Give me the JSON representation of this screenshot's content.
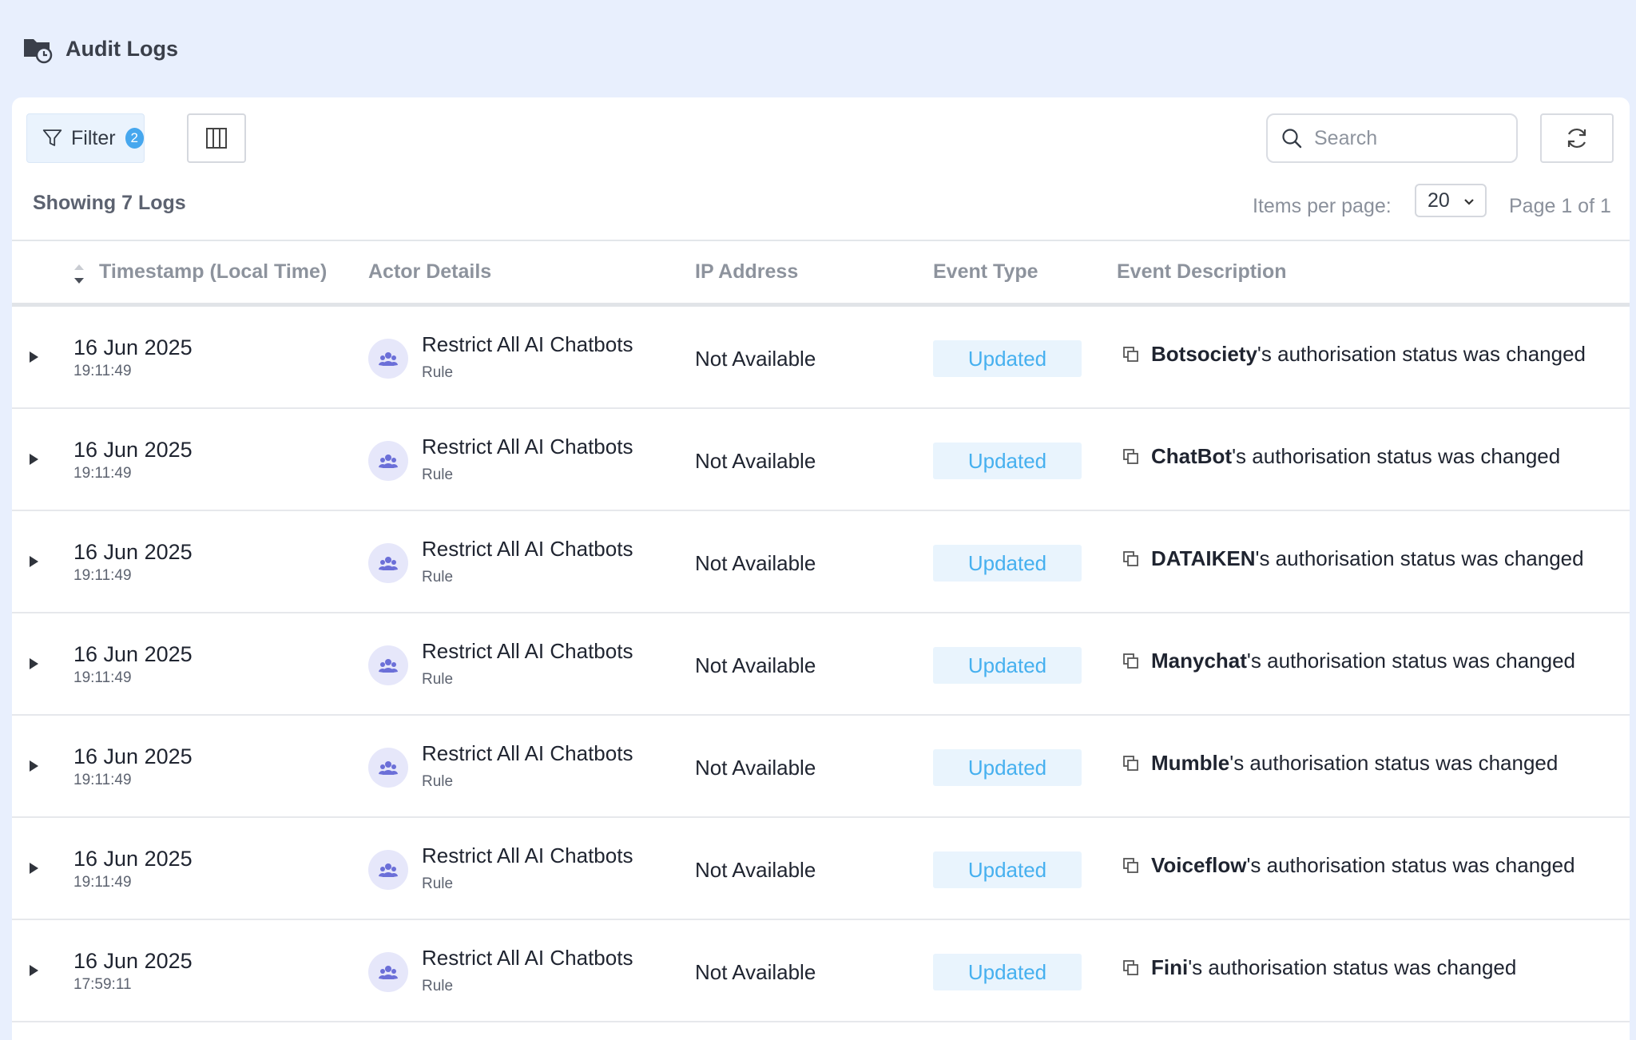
{
  "page": {
    "title": "Audit Logs",
    "icon": "folder-clock-icon"
  },
  "toolbar": {
    "filter_label": "Filter",
    "filter_count": "2",
    "search_placeholder": "Search"
  },
  "summary": {
    "showing": "Showing 7 Logs",
    "items_per_page_label": "Items per page:",
    "items_per_page_value": "20",
    "page_info": "Page 1 of 1"
  },
  "columns": {
    "timestamp": "Timestamp (Local Time)",
    "actor": "Actor Details",
    "ip": "IP Address",
    "event_type": "Event Type",
    "event_desc": "Event Description"
  },
  "rows": [
    {
      "date": "16 Jun 2025",
      "time": "19:11:49",
      "actor_name": "Restrict All AI Chatbots",
      "actor_type": "Rule",
      "ip": "Not Available",
      "event_type": "Updated",
      "desc_subject": "Botsociety",
      "desc_rest": "'s authorisation status was changed"
    },
    {
      "date": "16 Jun 2025",
      "time": "19:11:49",
      "actor_name": "Restrict All AI Chatbots",
      "actor_type": "Rule",
      "ip": "Not Available",
      "event_type": "Updated",
      "desc_subject": "ChatBot",
      "desc_rest": "'s authorisation status was changed"
    },
    {
      "date": "16 Jun 2025",
      "time": "19:11:49",
      "actor_name": "Restrict All AI Chatbots",
      "actor_type": "Rule",
      "ip": "Not Available",
      "event_type": "Updated",
      "desc_subject": "DATAIKEN",
      "desc_rest": "'s authorisation status was changed"
    },
    {
      "date": "16 Jun 2025",
      "time": "19:11:49",
      "actor_name": "Restrict All AI Chatbots",
      "actor_type": "Rule",
      "ip": "Not Available",
      "event_type": "Updated",
      "desc_subject": "Manychat",
      "desc_rest": "'s authorisation status was changed"
    },
    {
      "date": "16 Jun 2025",
      "time": "19:11:49",
      "actor_name": "Restrict All AI Chatbots",
      "actor_type": "Rule",
      "ip": "Not Available",
      "event_type": "Updated",
      "desc_subject": "Mumble",
      "desc_rest": "'s authorisation status was changed"
    },
    {
      "date": "16 Jun 2025",
      "time": "19:11:49",
      "actor_name": "Restrict All AI Chatbots",
      "actor_type": "Rule",
      "ip": "Not Available",
      "event_type": "Updated",
      "desc_subject": "Voiceflow",
      "desc_rest": "'s authorisation status was changed"
    },
    {
      "date": "16 Jun 2025",
      "time": "17:59:11",
      "actor_name": "Restrict All AI Chatbots",
      "actor_type": "Rule",
      "ip": "Not Available",
      "event_type": "Updated",
      "desc_subject": "Fini",
      "desc_rest": "'s authorisation status was changed"
    }
  ],
  "colors": {
    "page_bg": "#e8effd",
    "accent": "#46a7ee",
    "badge_bg": "#e9f4fd",
    "badge_text": "#46b0ef",
    "avatar_bg": "#e6e7fa",
    "avatar_fg": "#6b6fd8"
  }
}
